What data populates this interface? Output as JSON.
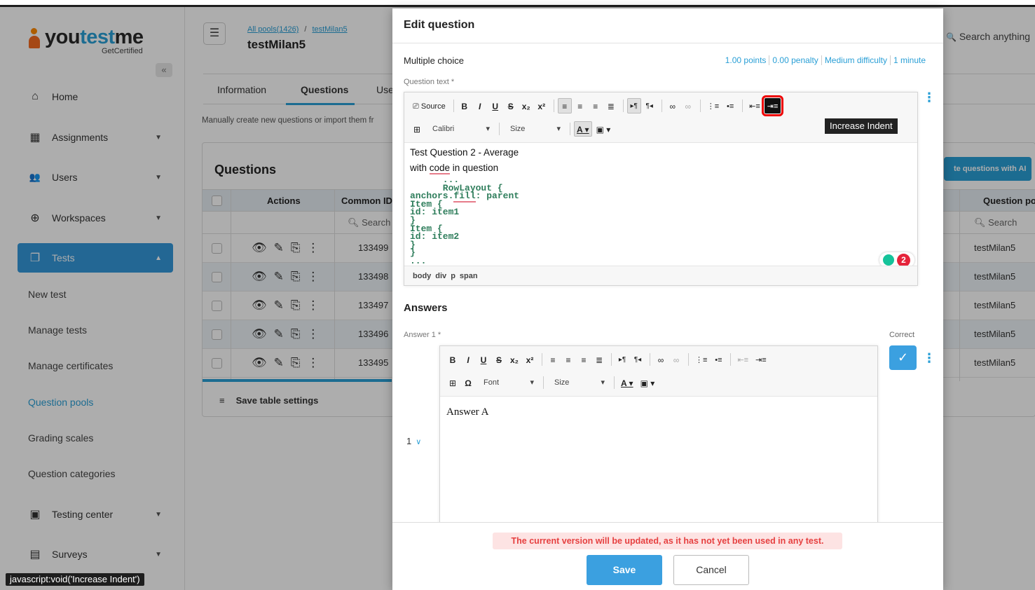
{
  "brand": {
    "name_part1": "you",
    "name_accent": "test",
    "name_part2": "me",
    "sub": "GetCertified"
  },
  "sidebar": {
    "collapse": "«",
    "items": [
      {
        "label": "Home",
        "icon": "home-icon",
        "glyph": "⌂"
      },
      {
        "label": "Assignments",
        "icon": "assignments-icon",
        "glyph": "▦"
      },
      {
        "label": "Users",
        "icon": "users-icon",
        "glyph": "👥"
      },
      {
        "label": "Workspaces",
        "icon": "globe-icon",
        "glyph": "⊕"
      },
      {
        "label": "Tests",
        "icon": "tests-icon",
        "glyph": "❐"
      },
      {
        "label": "Testing center",
        "icon": "monitor-icon",
        "glyph": "▣"
      },
      {
        "label": "Surveys",
        "icon": "surveys-icon",
        "glyph": "▤"
      }
    ],
    "sub_items": [
      "New test",
      "Manage tests",
      "Manage certificates",
      "Question pools",
      "Grading scales",
      "Question categories"
    ]
  },
  "status_bar": "javascript:void('Increase Indent')",
  "header": {
    "menu_glyph": "☰",
    "breadcrumb": [
      "All pools(1426)",
      "/",
      "testMilan5"
    ],
    "title": "testMilan5",
    "search_placeholder": "Search anything",
    "search_glyph": "🔍"
  },
  "tabs": [
    "Information",
    "Questions",
    "Use"
  ],
  "hint": "Manually create new questions or import them fr",
  "questions_card": {
    "title": "Questions",
    "ai_button": "te questions with AI",
    "columns": [
      "Actions",
      "Common ID",
      "Question po"
    ],
    "search_placeholder": "Search",
    "rows": [
      {
        "id": "133499",
        "pool": "testMilan5"
      },
      {
        "id": "133498",
        "pool": "testMilan5"
      },
      {
        "id": "133497",
        "pool": "testMilan5"
      },
      {
        "id": "133496",
        "pool": "testMilan5"
      },
      {
        "id": "133495",
        "pool": "testMilan5"
      }
    ],
    "action_glyphs": "👁✎⎘⋮",
    "save_settings": "Save table settings",
    "save_glyph": "≡"
  },
  "modal": {
    "title": "Edit question",
    "type": "Multiple choice",
    "meta": [
      "1.00 points",
      "0.00 penalty",
      "Medium difficulty",
      "1 minute"
    ],
    "question_label": "Question text *",
    "toolbar": {
      "source": "Source",
      "font": "Calibri",
      "size": "Size",
      "tooltip": "Increase Indent"
    },
    "question_lines": [
      "Test Question 2 - Average",
      "with ",
      "code",
      " in question"
    ],
    "code_block": {
      "ticks": "      ...",
      "l1": "      RowLayout {",
      "l2a": "anchors.",
      "l2b": "fill",
      "l2c": ": parent",
      "rest": "Item {\nid: item1\n}\nItem {\nid: item2\n}\n}\n..."
    },
    "grammarly_count": "2",
    "path": [
      "body",
      "div",
      "p",
      "span"
    ],
    "answers_title": "Answers",
    "answer_label": "Answer 1 *",
    "correct_label": "Correct",
    "answer_order": "1",
    "answer_toolbar": {
      "font": "Font",
      "size": "Size"
    },
    "answer_text": "Answer A",
    "warning": "The current version will be updated, as it has not yet been used in any test.",
    "save": "Save",
    "cancel": "Cancel"
  },
  "colors": {
    "accent": "#2a9fd6",
    "brand_orange": "#f36b21",
    "warning_text": "#e64040",
    "code_green": "#2e7d5b"
  }
}
